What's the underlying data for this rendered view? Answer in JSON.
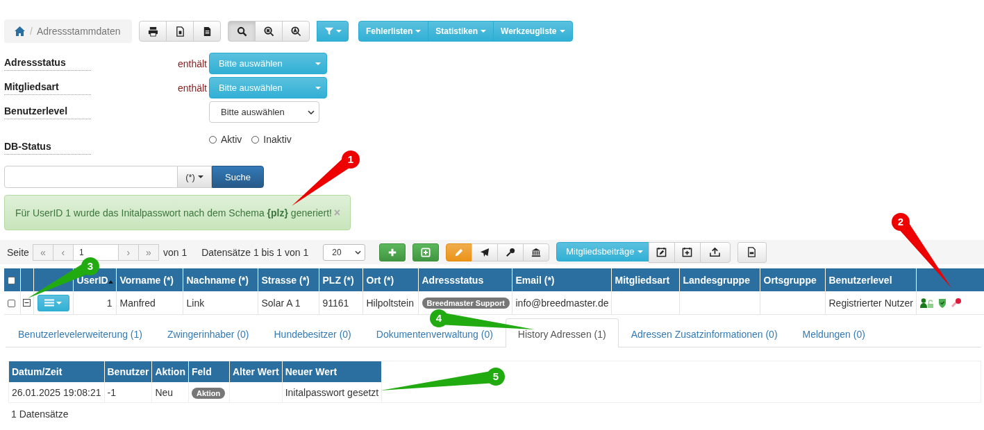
{
  "breadcrumb": {
    "separator": "/",
    "current": "Adressstammdaten"
  },
  "menus": [
    {
      "label": "Fehlerlisten"
    },
    {
      "label": "Statistiken"
    },
    {
      "label": "Werkzeugliste"
    }
  ],
  "filters": [
    {
      "label": "Adressstatus",
      "kind": "dropdown",
      "operator": "enthält",
      "value": "Bitte auswählen"
    },
    {
      "label": "Mitgliedsart",
      "kind": "dropdown",
      "operator": "enthält",
      "value": "Bitte auswählen"
    },
    {
      "label": "Benutzerlevel",
      "kind": "select",
      "value": "Bitte auswählen"
    },
    {
      "label": "DB-Status",
      "kind": "radio",
      "options": [
        {
          "label": "Aktiv",
          "selected": false
        },
        {
          "label": "Inaktiv",
          "selected": false
        }
      ]
    }
  ],
  "search": {
    "mode": "(*)",
    "button": "Suche"
  },
  "alert": {
    "message": "Für UserID 1 wurde das Initalpasswort nach dem Schema **{plz}** generiert!",
    "close": "×"
  },
  "pager": {
    "page_label": "Seite",
    "nav_prev": [
      "«",
      "‹"
    ],
    "page": "1",
    "nav_next": [
      "›",
      "»"
    ],
    "of": "von 1",
    "records": "Datensätze 1 bis 1 von 1",
    "page_size": "20"
  },
  "actions": {
    "fees_menu": "Mitgliedsbeiträge"
  },
  "table": {
    "header_checked": false,
    "columns": [
      "UserID",
      "Vorname (*)",
      "Nachname (*)",
      "Strasse (*)",
      "PLZ (*)",
      "Ort (*)",
      "Adressstatus",
      "Email (*)",
      "Mitgliedsart",
      "Landesgruppe",
      "Ortsgruppe",
      "Benutzerlevel"
    ],
    "rows": [
      {
        "checked": false,
        "expanded": true,
        "cells": [
          {
            "kind": "number",
            "text": "1"
          },
          {
            "kind": "text",
            "text": "Manfred"
          },
          {
            "kind": "text",
            "text": "Link"
          },
          {
            "kind": "text",
            "text": "Solar A 1"
          },
          {
            "kind": "text",
            "text": "91161"
          },
          {
            "kind": "text",
            "text": "Hilpoltstein"
          },
          {
            "kind": "badge",
            "text": "Breedmaster Support"
          },
          {
            "kind": "text",
            "text": "info@breedmaster.de"
          },
          {
            "kind": "empty"
          },
          {
            "kind": "empty"
          },
          {
            "kind": "empty"
          },
          {
            "kind": "text",
            "text": "Registrierter Nutzer"
          }
        ]
      }
    ]
  },
  "tabs": [
    {
      "label": "Benutzerlevelerweiterung (1)",
      "selected": false
    },
    {
      "label": "Zwingerinhaber (0)",
      "selected": false
    },
    {
      "label": "Hundebesitzer (0)",
      "selected": false
    },
    {
      "label": "Dokumentenverwaltung (0)",
      "selected": false
    },
    {
      "label": "History Adressen (1)",
      "selected": true
    },
    {
      "label": "Adressen Zusatzinformationen (0)",
      "selected": false
    },
    {
      "label": "Meldungen (0)",
      "selected": false
    }
  ],
  "history": {
    "columns": [
      "Datum/Zeit",
      "Benutzer",
      "Aktion",
      "Feld",
      "Alter Wert",
      "Neuer Wert"
    ],
    "rows": [
      {
        "cells": [
          {
            "kind": "text",
            "text": "26.01.2025 19:08:21"
          },
          {
            "kind": "text",
            "text": "-1"
          },
          {
            "kind": "text",
            "text": "Neu"
          },
          {
            "kind": "badge",
            "text": "Aktion"
          },
          {
            "kind": "empty"
          },
          {
            "kind": "text",
            "text": "Initalpasswort gesetzt"
          }
        ]
      }
    ],
    "count": "1 Datensätze"
  },
  "callouts": [
    {
      "number": "1",
      "color": "#ee0000"
    },
    {
      "number": "2",
      "color": "#ee0000"
    },
    {
      "number": "3",
      "color": "#22aa11"
    },
    {
      "number": "4",
      "color": "#22aa11"
    },
    {
      "number": "5",
      "color": "#22aa11"
    }
  ]
}
